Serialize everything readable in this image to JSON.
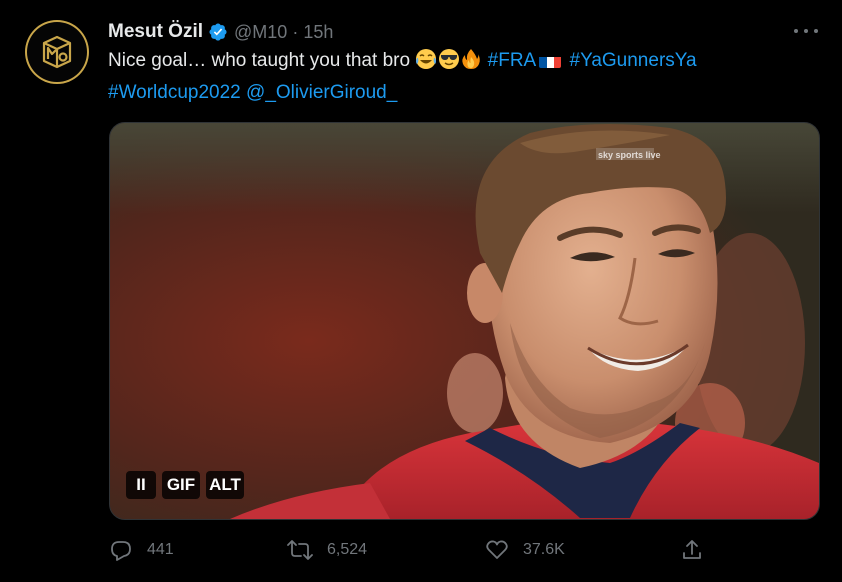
{
  "tweet": {
    "author_name": "Mesut Özil",
    "handle": "@M10",
    "separator": "·",
    "time": "15h",
    "text": {
      "line1_plain": "Nice goal… who taught you that bro",
      "emojis": [
        "face-with-tears-of-joy",
        "smiling-face-with-sunglasses",
        "fire"
      ],
      "hashtag_fra": "#FRA",
      "flag": "france-flag",
      "hashtag_yagunnersya": "#YaGunnersYa",
      "hashtag_worldcup": "#Worldcup2022",
      "mention": "@_OlivierGiroud_"
    },
    "media": {
      "type": "gif",
      "watermark": "sky sports live"
    },
    "gif_controls": {
      "pause_label": "II",
      "gif_label": "GIF",
      "alt_label": "ALT"
    },
    "actions": {
      "replies": "441",
      "retweets": "6,524",
      "likes": "37.6K"
    }
  },
  "colors": {
    "background": "#000000",
    "text": "#e7e9ea",
    "secondary": "#71767b",
    "link": "#1d9bf0",
    "verified": "#1d9bf0",
    "avatar_gold": "#c9a64a"
  }
}
